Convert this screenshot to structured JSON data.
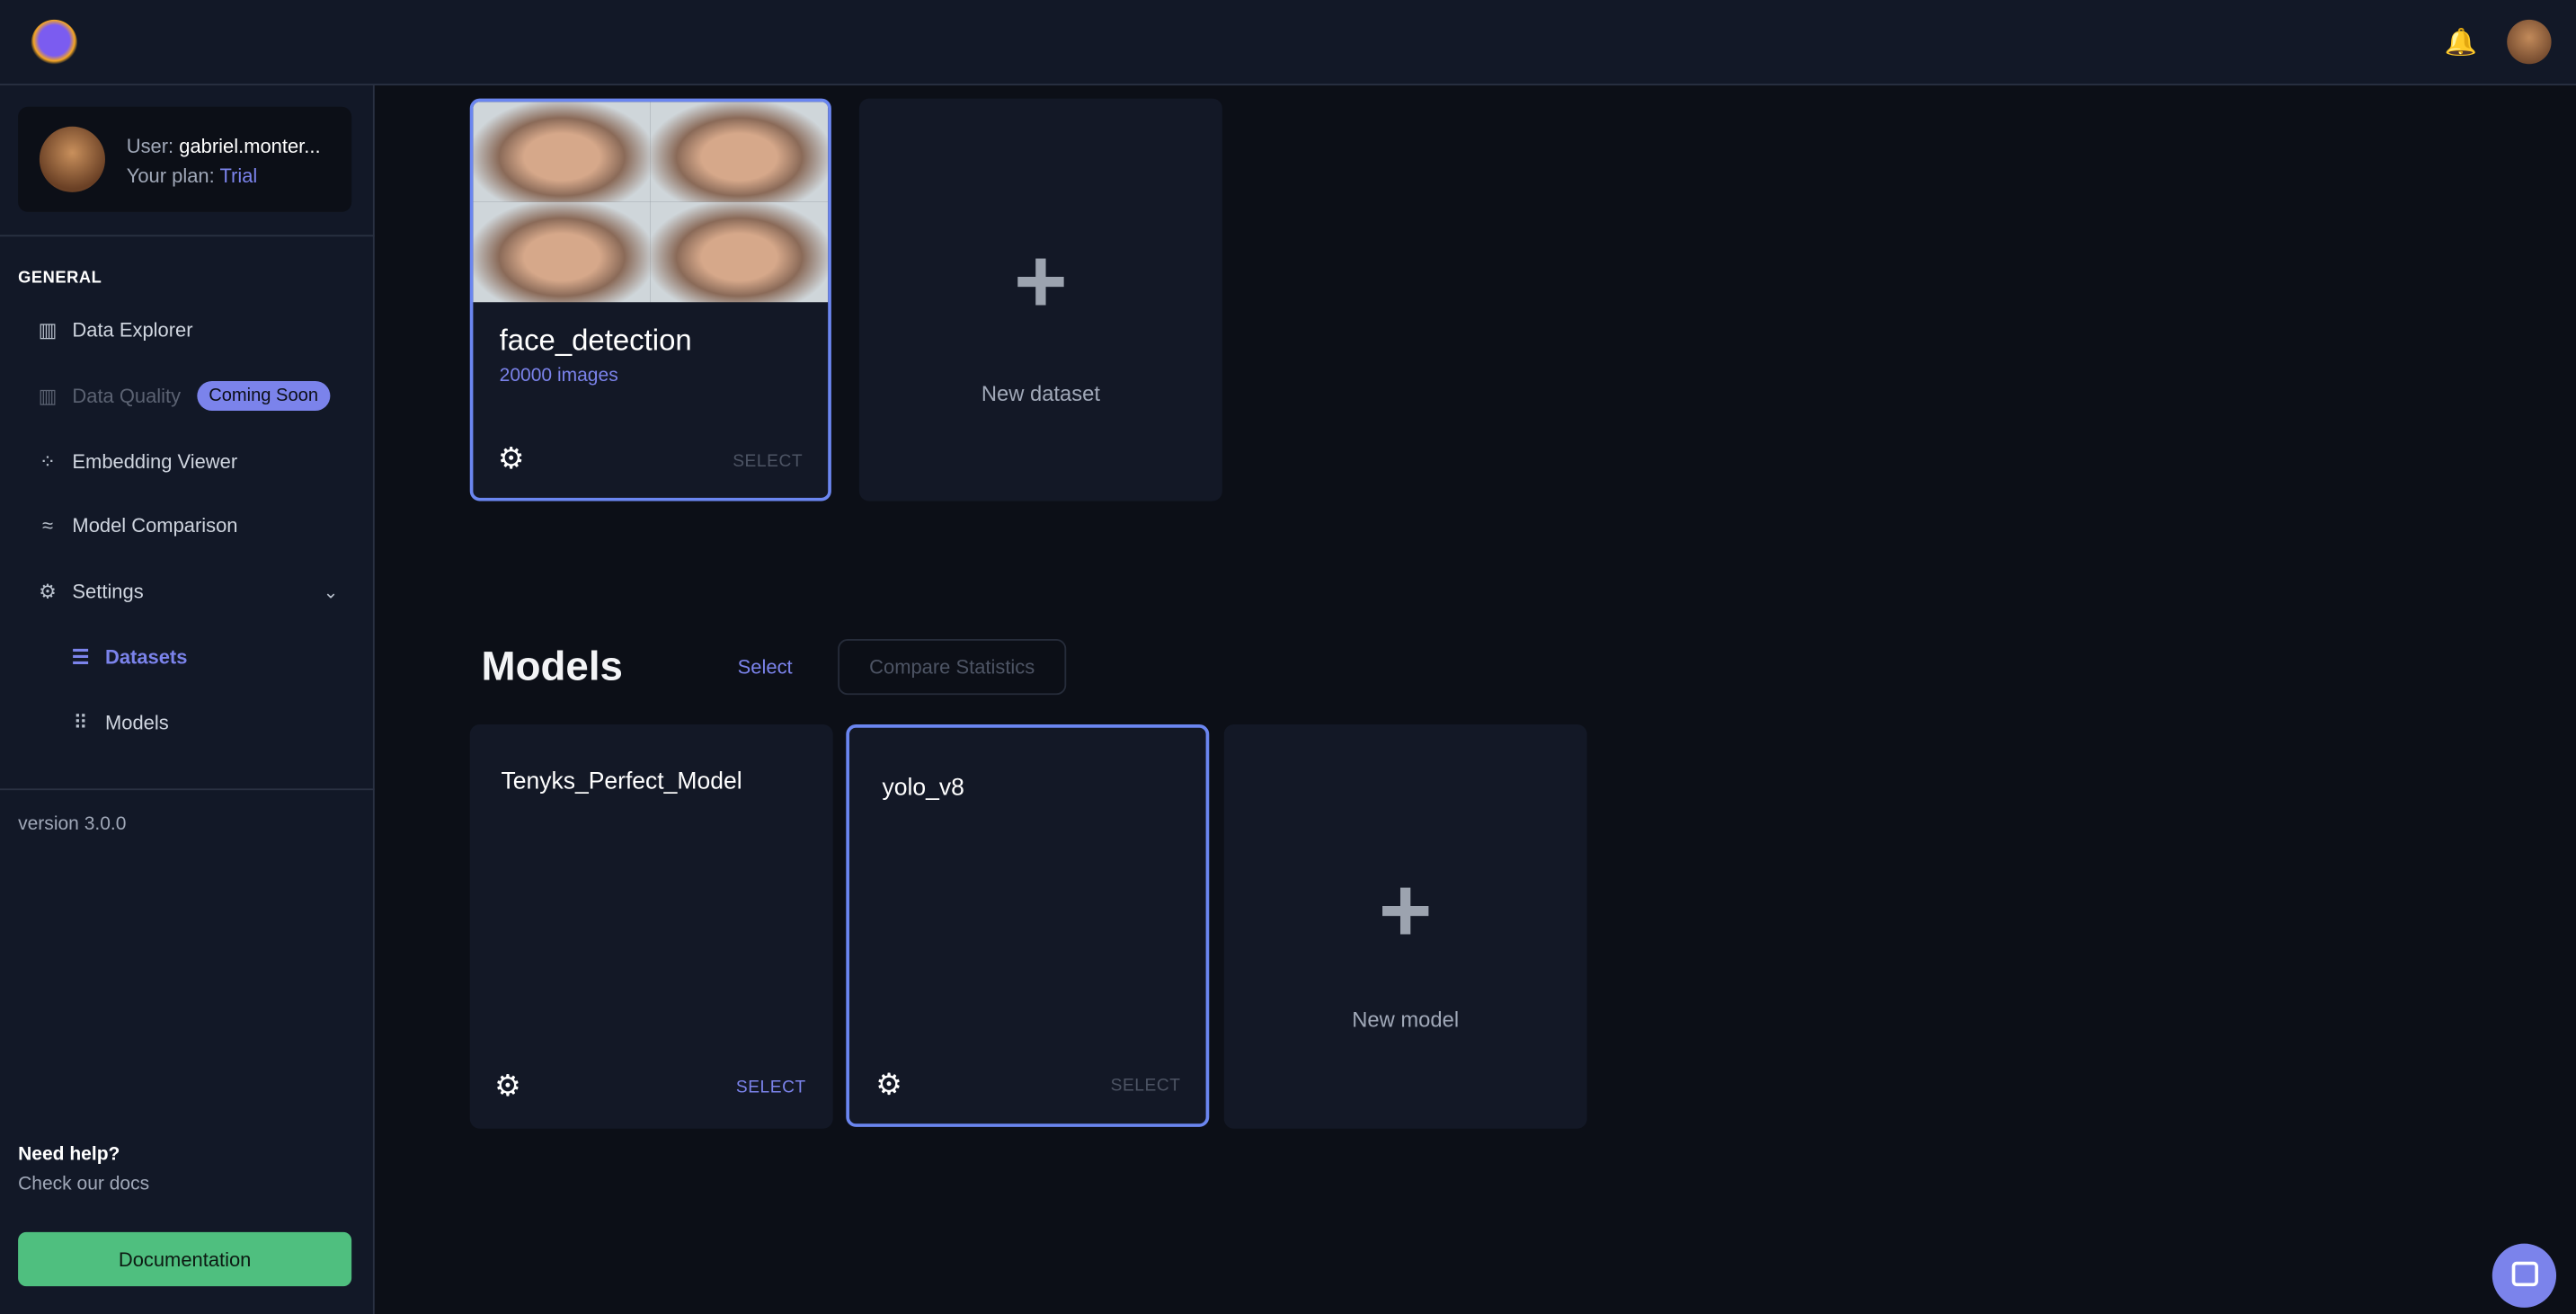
{
  "header": {
    "logo": "Tenyks",
    "bell_icon": "bell-icon"
  },
  "user": {
    "label": "User:",
    "name": "gabriel.monter...",
    "plan_label": "Your plan:",
    "plan": "Trial"
  },
  "sidebar": {
    "section": "GENERAL",
    "items": [
      {
        "label": "Data Explorer",
        "icon": "bar-chart-icon"
      },
      {
        "label": "Data Quality",
        "icon": "bar-chart-icon",
        "badge": "Coming Soon"
      },
      {
        "label": "Embedding Viewer",
        "icon": "scatter-dots-icon"
      },
      {
        "label": "Model Comparison",
        "icon": "wave-lines-icon"
      },
      {
        "label": "Settings",
        "icon": "gear-icon"
      }
    ],
    "sub_items": [
      {
        "label": "Datasets",
        "icon": "list-icon",
        "active": true
      },
      {
        "label": "Models",
        "icon": "grid-icon"
      }
    ],
    "version": "version 3.0.0",
    "help_title": "Need help?",
    "help_sub": "Check our docs",
    "doc_button": "Documentation"
  },
  "datasets": [
    {
      "name": "face_detection",
      "count": "20000 images",
      "select": "SELECT"
    }
  ],
  "new_dataset": "New dataset",
  "models_section": {
    "title": "Models",
    "select_link": "Select",
    "compare_button": "Compare Statistics"
  },
  "models": [
    {
      "name": "Tenyks_Perfect_Model",
      "select": "SELECT"
    },
    {
      "name": "yolo_v8",
      "select": "SELECT"
    }
  ],
  "new_model": "New model",
  "plus": "+",
  "colors": {
    "accent": "#7b83eb",
    "selected_border": "#6b86f0",
    "doc_button": "#4fbf7f"
  }
}
